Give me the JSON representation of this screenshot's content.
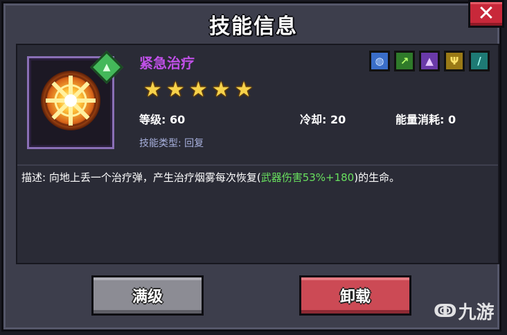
{
  "dialog": {
    "title": "技能信息",
    "close_label": "✕"
  },
  "skill": {
    "name": "紧急治疗",
    "stars": [
      "★",
      "★",
      "★",
      "★",
      "★"
    ],
    "level_label": "等级: 60",
    "cooldown_label": "冷却: 20",
    "energy_label": "能量消耗: 0",
    "type_label": "技能类型: 回复",
    "desc_prefix": "描述: 向地上丢一个治疗弹，产生治疗烟雾每次恢复(",
    "desc_highlight": "武器伤害53%+180",
    "desc_suffix": ")的生命。"
  },
  "class_icons": [
    {
      "name": "shield-class-icon",
      "glyph": "◍",
      "bg": "#3a6ec8",
      "fg": "#cfe3ff"
    },
    {
      "name": "bow-class-icon",
      "glyph": "↗",
      "bg": "#2f7a2a",
      "fg": "#b8ff6a"
    },
    {
      "name": "wizard-hat-class-icon",
      "glyph": "▲",
      "bg": "#6a3aa8",
      "fg": "#e6c8ff"
    },
    {
      "name": "staff-class-icon",
      "glyph": "Ψ",
      "bg": "#9a7a16",
      "fg": "#ffe36a"
    },
    {
      "name": "sword-class-icon",
      "glyph": "/",
      "bg": "#1e7a74",
      "fg": "#a8fff2"
    }
  ],
  "buttons": {
    "max_level": "满级",
    "unload": "卸载"
  },
  "watermark": {
    "mark": "ↂ",
    "text": "九游"
  },
  "colors": {
    "skill_name": "#c050e8",
    "highlight": "#68e05e",
    "close": "#c8283a",
    "unload": "#cc4a55"
  }
}
